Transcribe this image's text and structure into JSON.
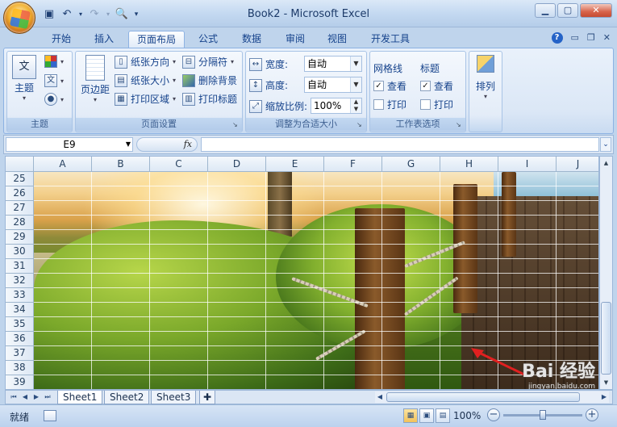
{
  "window": {
    "title": "Book2 - Microsoft Excel"
  },
  "tabs": [
    {
      "label": "开始"
    },
    {
      "label": "插入"
    },
    {
      "label": "页面布局"
    },
    {
      "label": "公式"
    },
    {
      "label": "数据"
    },
    {
      "label": "审阅"
    },
    {
      "label": "视图"
    },
    {
      "label": "开发工具"
    }
  ],
  "active_tab": "页面布局",
  "ribbon": {
    "theme": {
      "label": "主题",
      "btn": "主题",
      "icon_glyph": "文"
    },
    "page_setup": {
      "label": "页面设置",
      "margins": "页边距",
      "orientation": "纸张方向",
      "size": "纸张大小",
      "print_area": "打印区域",
      "breaks": "分隔符",
      "background": "删除背景",
      "print_titles": "打印标题"
    },
    "scale": {
      "label": "调整为合适大小",
      "width_label": "宽度:",
      "width_value": "自动",
      "height_label": "高度:",
      "height_value": "自动",
      "scale_label": "缩放比例:",
      "scale_value": "100%"
    },
    "sheet_options": {
      "label": "工作表选项",
      "gridlines": "网格线",
      "headings": "标题",
      "view": "查看",
      "print": "打印"
    },
    "arrange": {
      "label": "排列"
    }
  },
  "formula_bar": {
    "name_box": "E9",
    "fx": "fx",
    "content": ""
  },
  "grid": {
    "columns": [
      "A",
      "B",
      "C",
      "D",
      "E",
      "F",
      "G",
      "H",
      "I",
      "J"
    ],
    "rows": [
      "25",
      "26",
      "27",
      "28",
      "29",
      "30",
      "31",
      "32",
      "33",
      "34",
      "35",
      "36",
      "37",
      "38",
      "39"
    ]
  },
  "sheets": [
    "Sheet1",
    "Sheet2",
    "Sheet3"
  ],
  "active_sheet": "Sheet1",
  "status": {
    "ready": "就绪",
    "zoom": "100%",
    "zoom_level": 0.5
  },
  "watermark": {
    "brand": "Bai 经验",
    "url": "jingyan.baidu.com"
  },
  "colors": {
    "ribbon_accent": "#15428b",
    "annotation_arrow": "#e02020"
  }
}
